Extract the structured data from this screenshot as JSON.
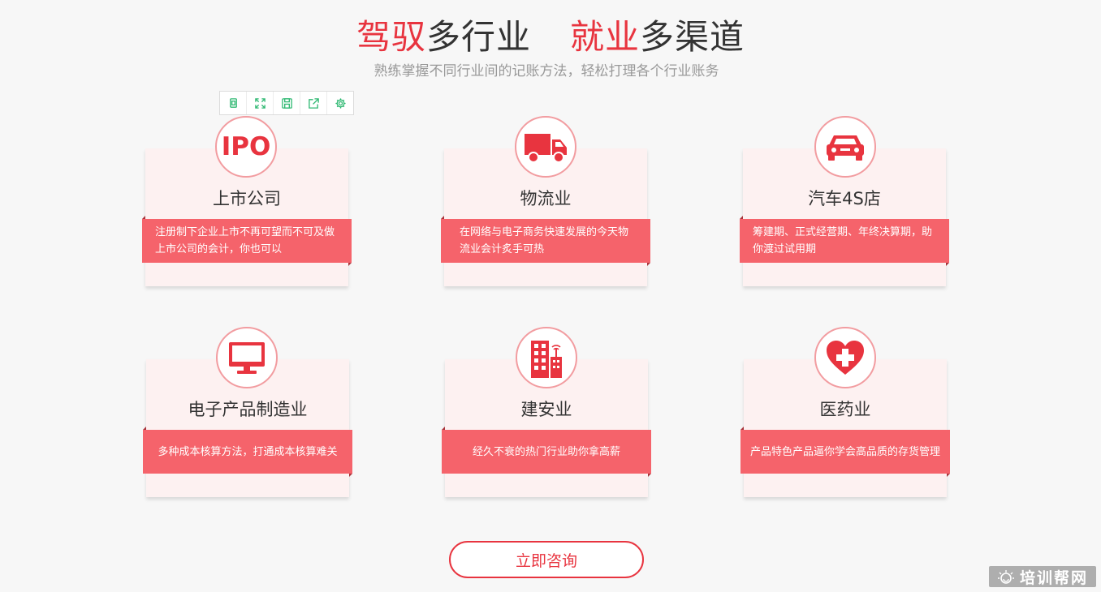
{
  "headline": {
    "part1_red": "驾驭",
    "part1_dark": "多行业",
    "part2_red": "就业",
    "part2_dark": "多渠道"
  },
  "subheadline": "熟练掌握不同行业间的记账方法，轻松打理各个行业账务",
  "toolbar": {
    "icons": [
      "copy-icon",
      "expand-icon",
      "save-icon",
      "share-icon",
      "settings-icon"
    ],
    "color": "#2fb872"
  },
  "accent_color": "#e8343f",
  "band_color": "#f5636b",
  "cards": [
    {
      "icon": "ipo-icon",
      "icon_text": "IPO",
      "title": "上市公司",
      "desc": "注册制下企业上市不再可望而不可及做上市公司的会计，你也可以"
    },
    {
      "icon": "truck-icon",
      "title": "物流业",
      "desc": "在网络与电子商务快速发展的今天物流业会计炙手可热"
    },
    {
      "icon": "car-icon",
      "title": "汽车4S店",
      "desc": "筹建期、正式经营期、年终决算期，助你渡过试用期"
    },
    {
      "icon": "monitor-icon",
      "title": "电子产品制造业",
      "desc": "多种成本核算方法，打通成本核算难关"
    },
    {
      "icon": "building-icon",
      "title": "建安业",
      "desc": "经久不衰的热门行业助你拿高薪"
    },
    {
      "icon": "medical-heart-icon",
      "title": "医药业",
      "desc": "产品特色产品逼你学会高品质的存货管理"
    }
  ],
  "consult_button": "立即咨询",
  "watermark": "培训帮网"
}
